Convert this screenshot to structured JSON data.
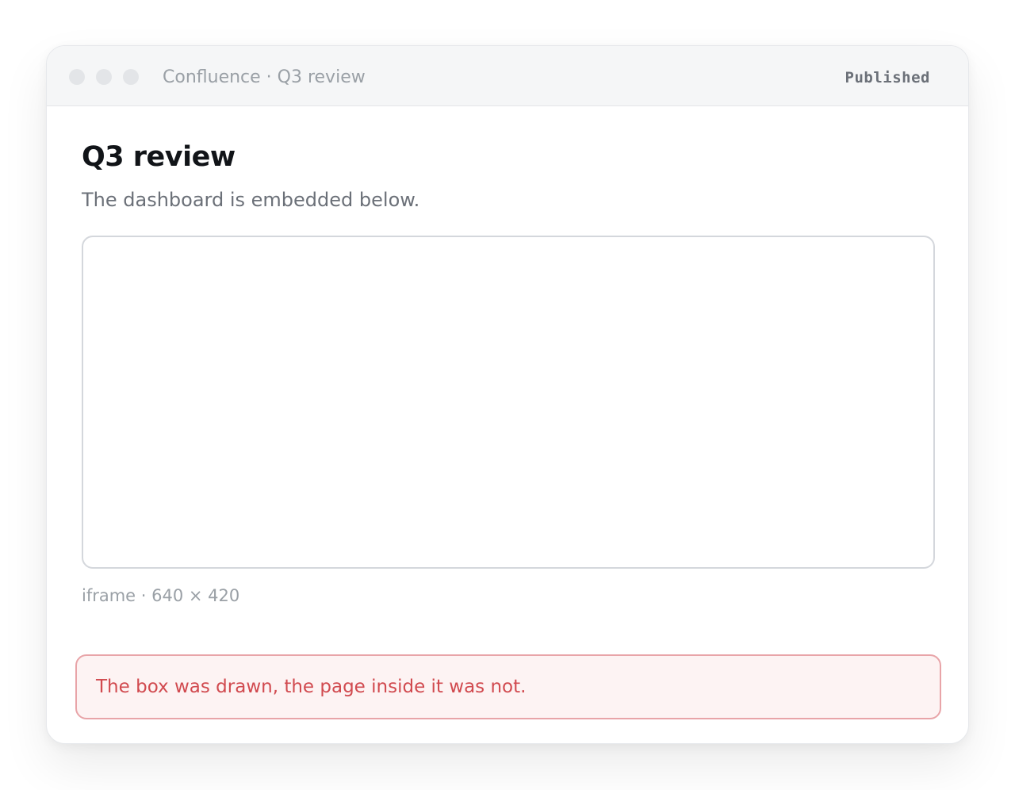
{
  "window": {
    "title": "Confluence · Q3 review",
    "status": "Published"
  },
  "page": {
    "title": "Q3 review",
    "subtitle": "The dashboard is embedded below."
  },
  "embed": {
    "caption": "iframe · 640 × 420"
  },
  "error": {
    "message": "The box was drawn, the page inside it was not."
  },
  "colors": {
    "error_text": "#d14a4f",
    "error_border": "#e8a4a8",
    "error_background": "#fdf3f3",
    "titlebar_background": "#f5f6f7"
  }
}
